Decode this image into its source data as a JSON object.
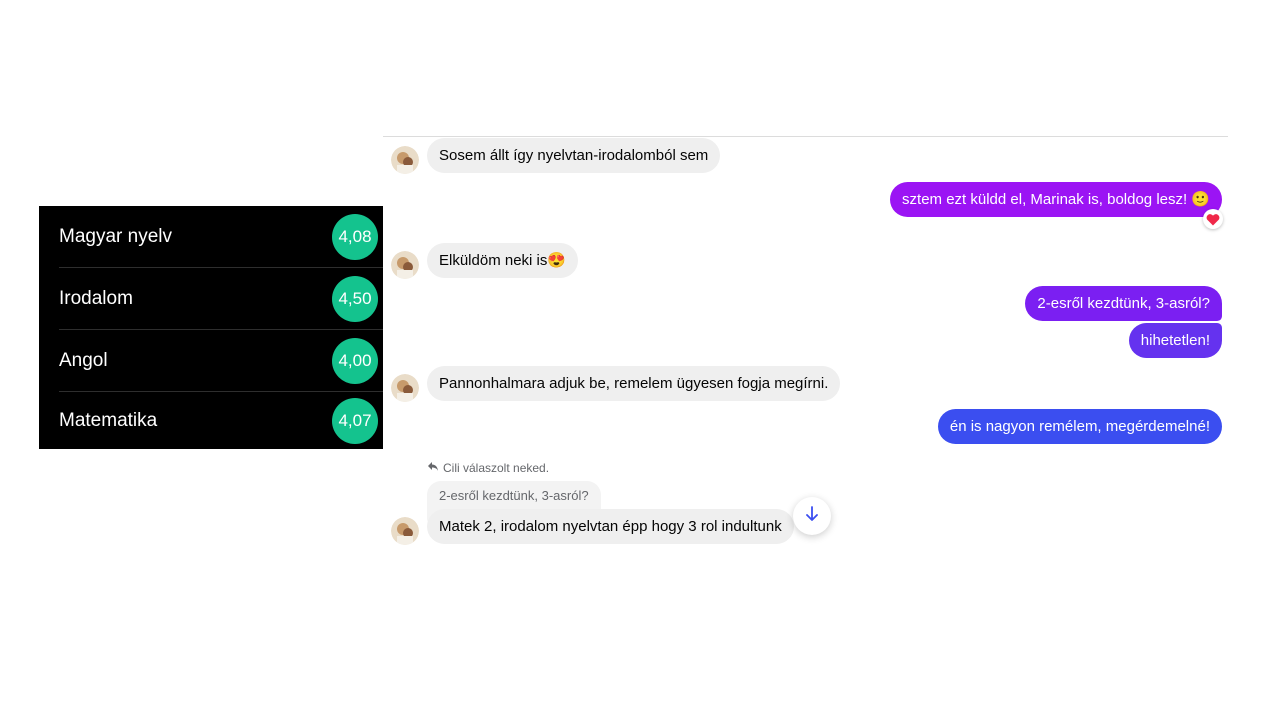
{
  "grades": [
    {
      "subject": "Magyar nyelv",
      "grade": "4,08"
    },
    {
      "subject": "Irodalom",
      "grade": "4,50"
    },
    {
      "subject": "Angol",
      "grade": "4,00"
    },
    {
      "subject": "Matematika",
      "grade": "4,07"
    }
  ],
  "colors": {
    "grade_badge": "#14c38e",
    "out_purple": "#9b14f4",
    "out_violet": "#6532ef",
    "out_blue": "#3b4ef0"
  },
  "messages": [
    {
      "side": "in",
      "text": "Sosem állt így nyelvtan-irodalomból sem"
    },
    {
      "side": "out",
      "text": "sztem ezt küldd el, Marinak is, boldog lesz! 🙂",
      "reaction": "❤️"
    },
    {
      "side": "in",
      "text": "Elküldöm neki is😍"
    },
    {
      "side": "out",
      "text": "2-esről kezdtünk, 3-asról?"
    },
    {
      "side": "out",
      "text": "hihetetlen!"
    },
    {
      "side": "in",
      "text": "Pannonhalmara adjuk be, remelem ügyesen fogja megírni."
    },
    {
      "side": "out",
      "text": "én is nagyon remélem, megérdemelné!"
    },
    {
      "side": "in",
      "text": "Matek 2, irodalom nyelvtan épp hogy 3 rol indultunk"
    }
  ],
  "reply": {
    "info": "Cili válaszolt neked.",
    "quoted": "2-esről kezdtünk, 3-asról?"
  },
  "icons": {
    "reply": "reply-arrow-icon",
    "scroll_down": "arrow-down-icon",
    "avatar": "user-avatar"
  }
}
